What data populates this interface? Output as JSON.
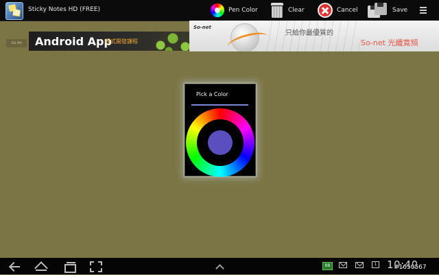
{
  "app": {
    "title": "Sticky Notes HD (FREE)"
  },
  "actionbar": {
    "pen_color_label": "Pen Color",
    "clear_label": "Clear",
    "cancel_label": "Cancel",
    "save_label": "Save"
  },
  "ads": {
    "small_label": "Go Ad",
    "banner1_main": "Android App",
    "banner1_sub": "程式開發課程",
    "banner2_logo": "So-net",
    "banner2_text": "只給你最優質的",
    "banner2_brand": "So-net 光纖寬頻"
  },
  "dialog": {
    "title": "Pick a Color",
    "selected_color": "#5b4fc0",
    "separator_color": "#7b86d4"
  },
  "statusbar": {
    "time": "10:40",
    "calendar_day": "1",
    "badge": "88",
    "watermark": "#1650567"
  },
  "colors": {
    "canvas_background": "#7b7444",
    "actionbar_background": "#0b0b0b",
    "navbar_background": "#050505"
  }
}
